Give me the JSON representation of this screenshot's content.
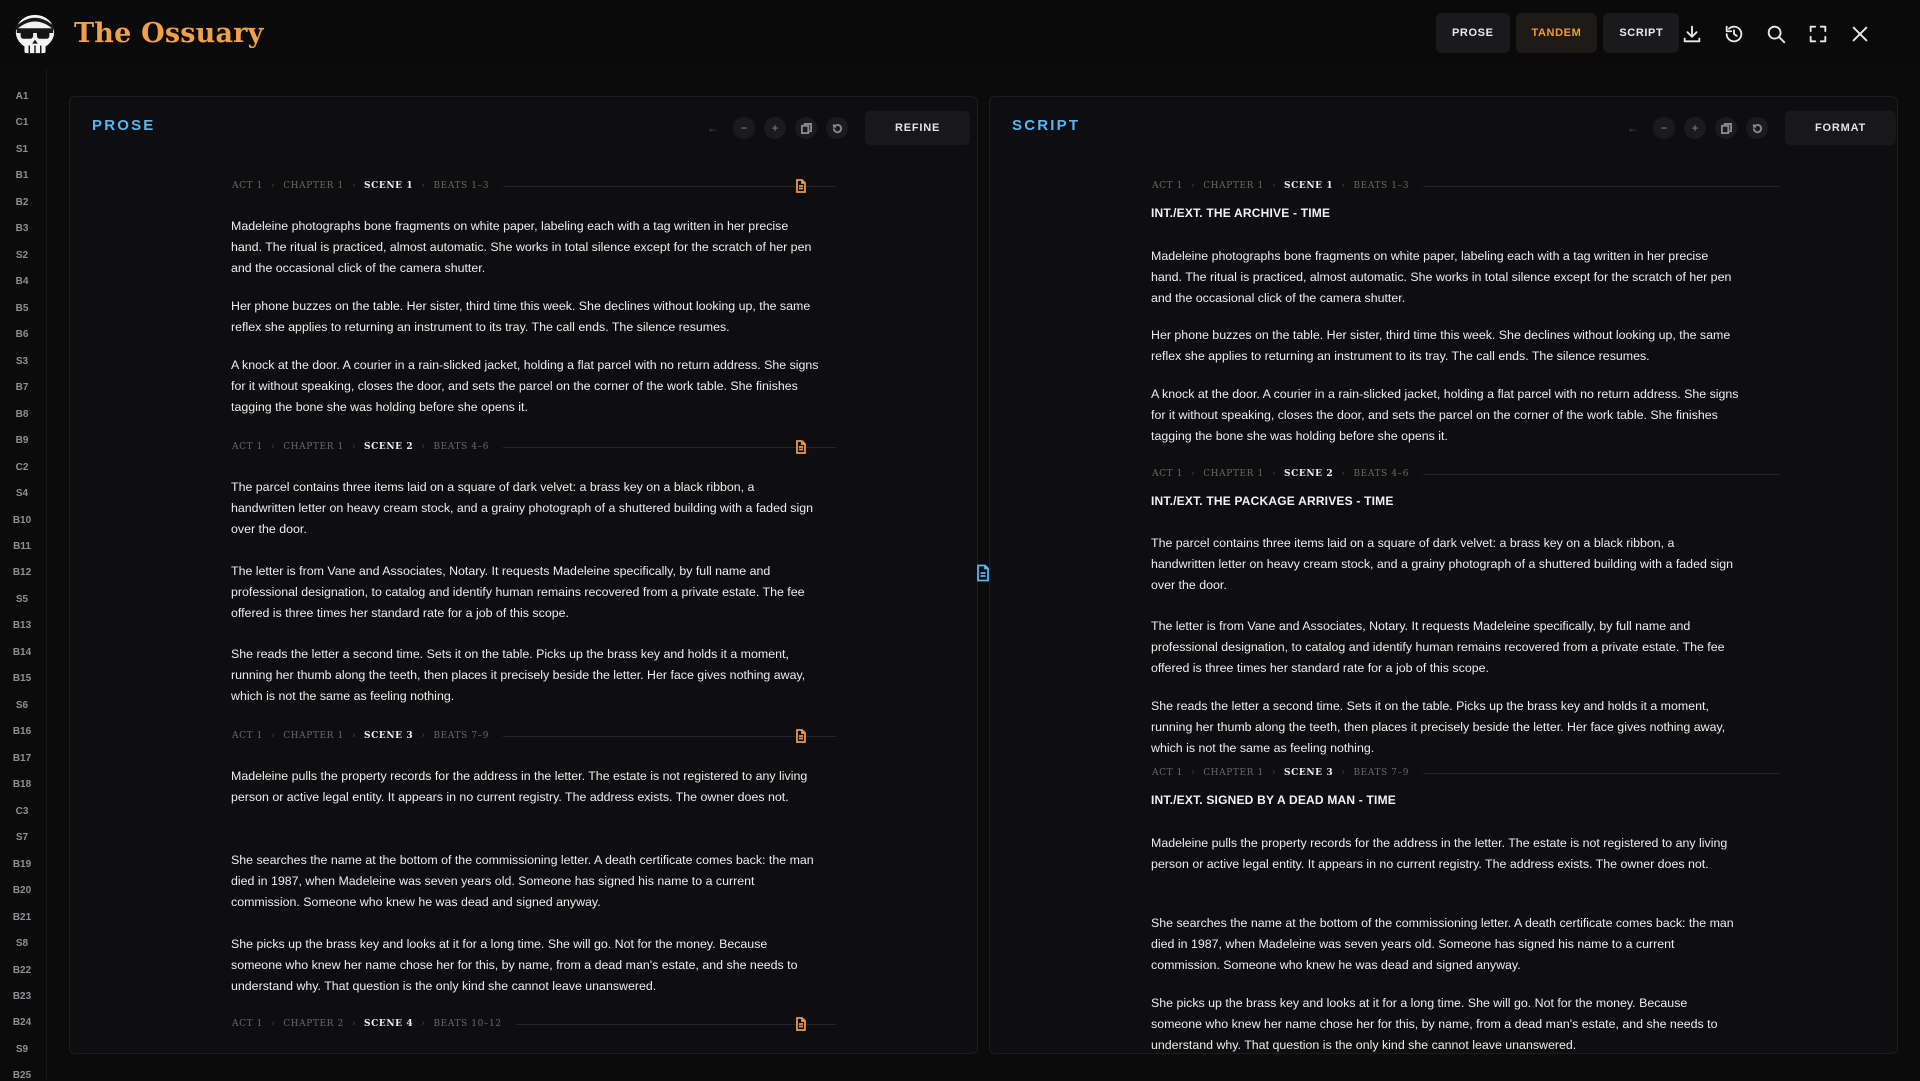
{
  "app": {
    "title": "The Ossuary"
  },
  "header": {
    "modes": [
      {
        "label": "PROSE",
        "active": false
      },
      {
        "label": "TANDEM",
        "active": true
      },
      {
        "label": "SCRIPT",
        "active": false
      }
    ],
    "icons": [
      "download-icon",
      "history-icon",
      "search-icon",
      "fullscreen-icon",
      "close-icon"
    ]
  },
  "rail": {
    "items": [
      "A1",
      "C1",
      "S1",
      "B1",
      "B2",
      "B3",
      "S2",
      "B4",
      "B5",
      "B6",
      "S3",
      "B7",
      "B8",
      "B9",
      "C2",
      "S4",
      "B10",
      "B11",
      "B12",
      "S5",
      "B13",
      "B14",
      "B15",
      "S6",
      "B16",
      "B17",
      "B18",
      "C3",
      "S7",
      "B19",
      "B20",
      "B21",
      "S8",
      "B22",
      "B23",
      "B24",
      "S9",
      "B25"
    ]
  },
  "prose": {
    "title": "PROSE",
    "action": "REFINE",
    "scenes": [
      {
        "crumb": {
          "act": "ACT 1",
          "chapter": "CHAPTER 1",
          "scene": "SCENE 1",
          "beats": "BEATS 1–3"
        },
        "paragraphs": [
          "Madeleine photographs bone fragments on white paper, labeling each with a tag written in her precise hand. The ritual is practiced, almost automatic. She works in total silence except for the scratch of her pen and the occasional click of the camera shutter.",
          "Her phone buzzes on the table. Her sister, third time this week. She declines without looking up, the same reflex she applies to returning an instrument to its tray. The call ends. The silence resumes.",
          "A knock at the door. A courier in a rain-slicked jacket, holding a flat parcel with no return address. She signs for it without speaking, closes the door, and sets the parcel on the corner of the work table. She finishes tagging the bone she was holding before she opens it."
        ]
      },
      {
        "crumb": {
          "act": "ACT 1",
          "chapter": "CHAPTER 1",
          "scene": "SCENE 2",
          "beats": "BEATS 4–6"
        },
        "paragraphs": [
          "The parcel contains three items laid on a square of dark velvet: a brass key on a black ribbon, a handwritten letter on heavy cream stock, and a grainy photograph of a shuttered building with a faded sign over the door.",
          "The letter is from Vane and Associates, Notary. It requests Madeleine specifically, by full name and professional designation, to catalog and identify human remains recovered from a private estate. The fee offered is three times her standard rate for a job of this scope.",
          "She reads the letter a second time. Sets it on the table. Picks up the brass key and holds it a moment, running her thumb along the teeth, then places it precisely beside the letter. Her face gives nothing away, which is not the same as feeling nothing."
        ]
      },
      {
        "crumb": {
          "act": "ACT 1",
          "chapter": "CHAPTER 1",
          "scene": "SCENE 3",
          "beats": "BEATS 7–9"
        },
        "paragraphs": [
          "Madeleine pulls the property records for the address in the letter. The estate is not registered to any living person or active legal entity. It appears in no current registry. The address exists. The owner does not.",
          "She searches the name at the bottom of the commissioning letter. A death certificate comes back: the man died in 1987, when Madeleine was seven years old. Someone has signed his name to a current commission. Someone who knew he was dead and signed anyway.",
          "She picks up the brass key and looks at it for a long time. She will go. Not for the money. Because someone who knew her name chose her for this, by name, from a dead man's estate, and she needs to understand why. That question is the only kind she cannot leave unanswered."
        ]
      },
      {
        "crumb": {
          "act": "ACT 1",
          "chapter": "CHAPTER 2",
          "scene": "SCENE 4",
          "beats": "BEATS 10–12"
        },
        "paragraphs": []
      }
    ]
  },
  "script": {
    "title": "SCRIPT",
    "action": "FORMAT",
    "scenes": [
      {
        "crumb": {
          "act": "ACT 1",
          "chapter": "CHAPTER 1",
          "scene": "SCENE 1",
          "beats": "BEATS 1–3"
        },
        "slug": "INT./EXT. THE ARCHIVE - TIME",
        "paragraphs": [
          "Madeleine photographs bone fragments on white paper, labeling each with a tag written in her precise hand. The ritual is practiced, almost automatic. She works in total silence except for the scratch of her pen and the occasional click of the camera shutter.",
          "Her phone buzzes on the table. Her sister, third time this week. She declines without looking up, the same reflex she applies to returning an instrument to its tray. The call ends. The silence resumes.",
          "A knock at the door. A courier in a rain-slicked jacket, holding a flat parcel with no return address. She signs for it without speaking, closes the door, and sets the parcel on the corner of the work table. She finishes tagging the bone she was holding before she opens it."
        ]
      },
      {
        "crumb": {
          "act": "ACT 1",
          "chapter": "CHAPTER 1",
          "scene": "SCENE 2",
          "beats": "BEATS 4–6"
        },
        "slug": "INT./EXT. THE PACKAGE ARRIVES - TIME",
        "paragraphs": [
          "The parcel contains three items laid on a square of dark velvet: a brass key on a black ribbon, a handwritten letter on heavy cream stock, and a grainy photograph of a shuttered building with a faded sign over the door.",
          "The letter is from Vane and Associates, Notary. It requests Madeleine specifically, by full name and professional designation, to catalog and identify human remains recovered from a private estate. The fee offered is three times her standard rate for a job of this scope.",
          "She reads the letter a second time. Sets it on the table. Picks up the brass key and holds it a moment, running her thumb along the teeth, then places it precisely beside the letter. Her face gives nothing away, which is not the same as feeling nothing."
        ]
      },
      {
        "crumb": {
          "act": "ACT 1",
          "chapter": "CHAPTER 1",
          "scene": "SCENE 3",
          "beats": "BEATS 7–9"
        },
        "slug": "INT./EXT. SIGNED BY A DEAD MAN - TIME",
        "paragraphs": [
          "Madeleine pulls the property records for the address in the letter. The estate is not registered to any living person or active legal entity. It appears in no current registry. The address exists. The owner does not.",
          "She searches the name at the bottom of the commissioning letter. A death certificate comes back: the man died in 1987, when Madeleine was seven years old. Someone has signed his name to a current commission. Someone who knew he was dead and signed anyway.",
          "She picks up the brass key and looks at it for a long time. She will go. Not for the money. Because someone who knew her name chose her for this, by name, from a dead man's estate, and she needs to understand why. That question is the only kind she cannot leave unanswered."
        ]
      }
    ]
  }
}
